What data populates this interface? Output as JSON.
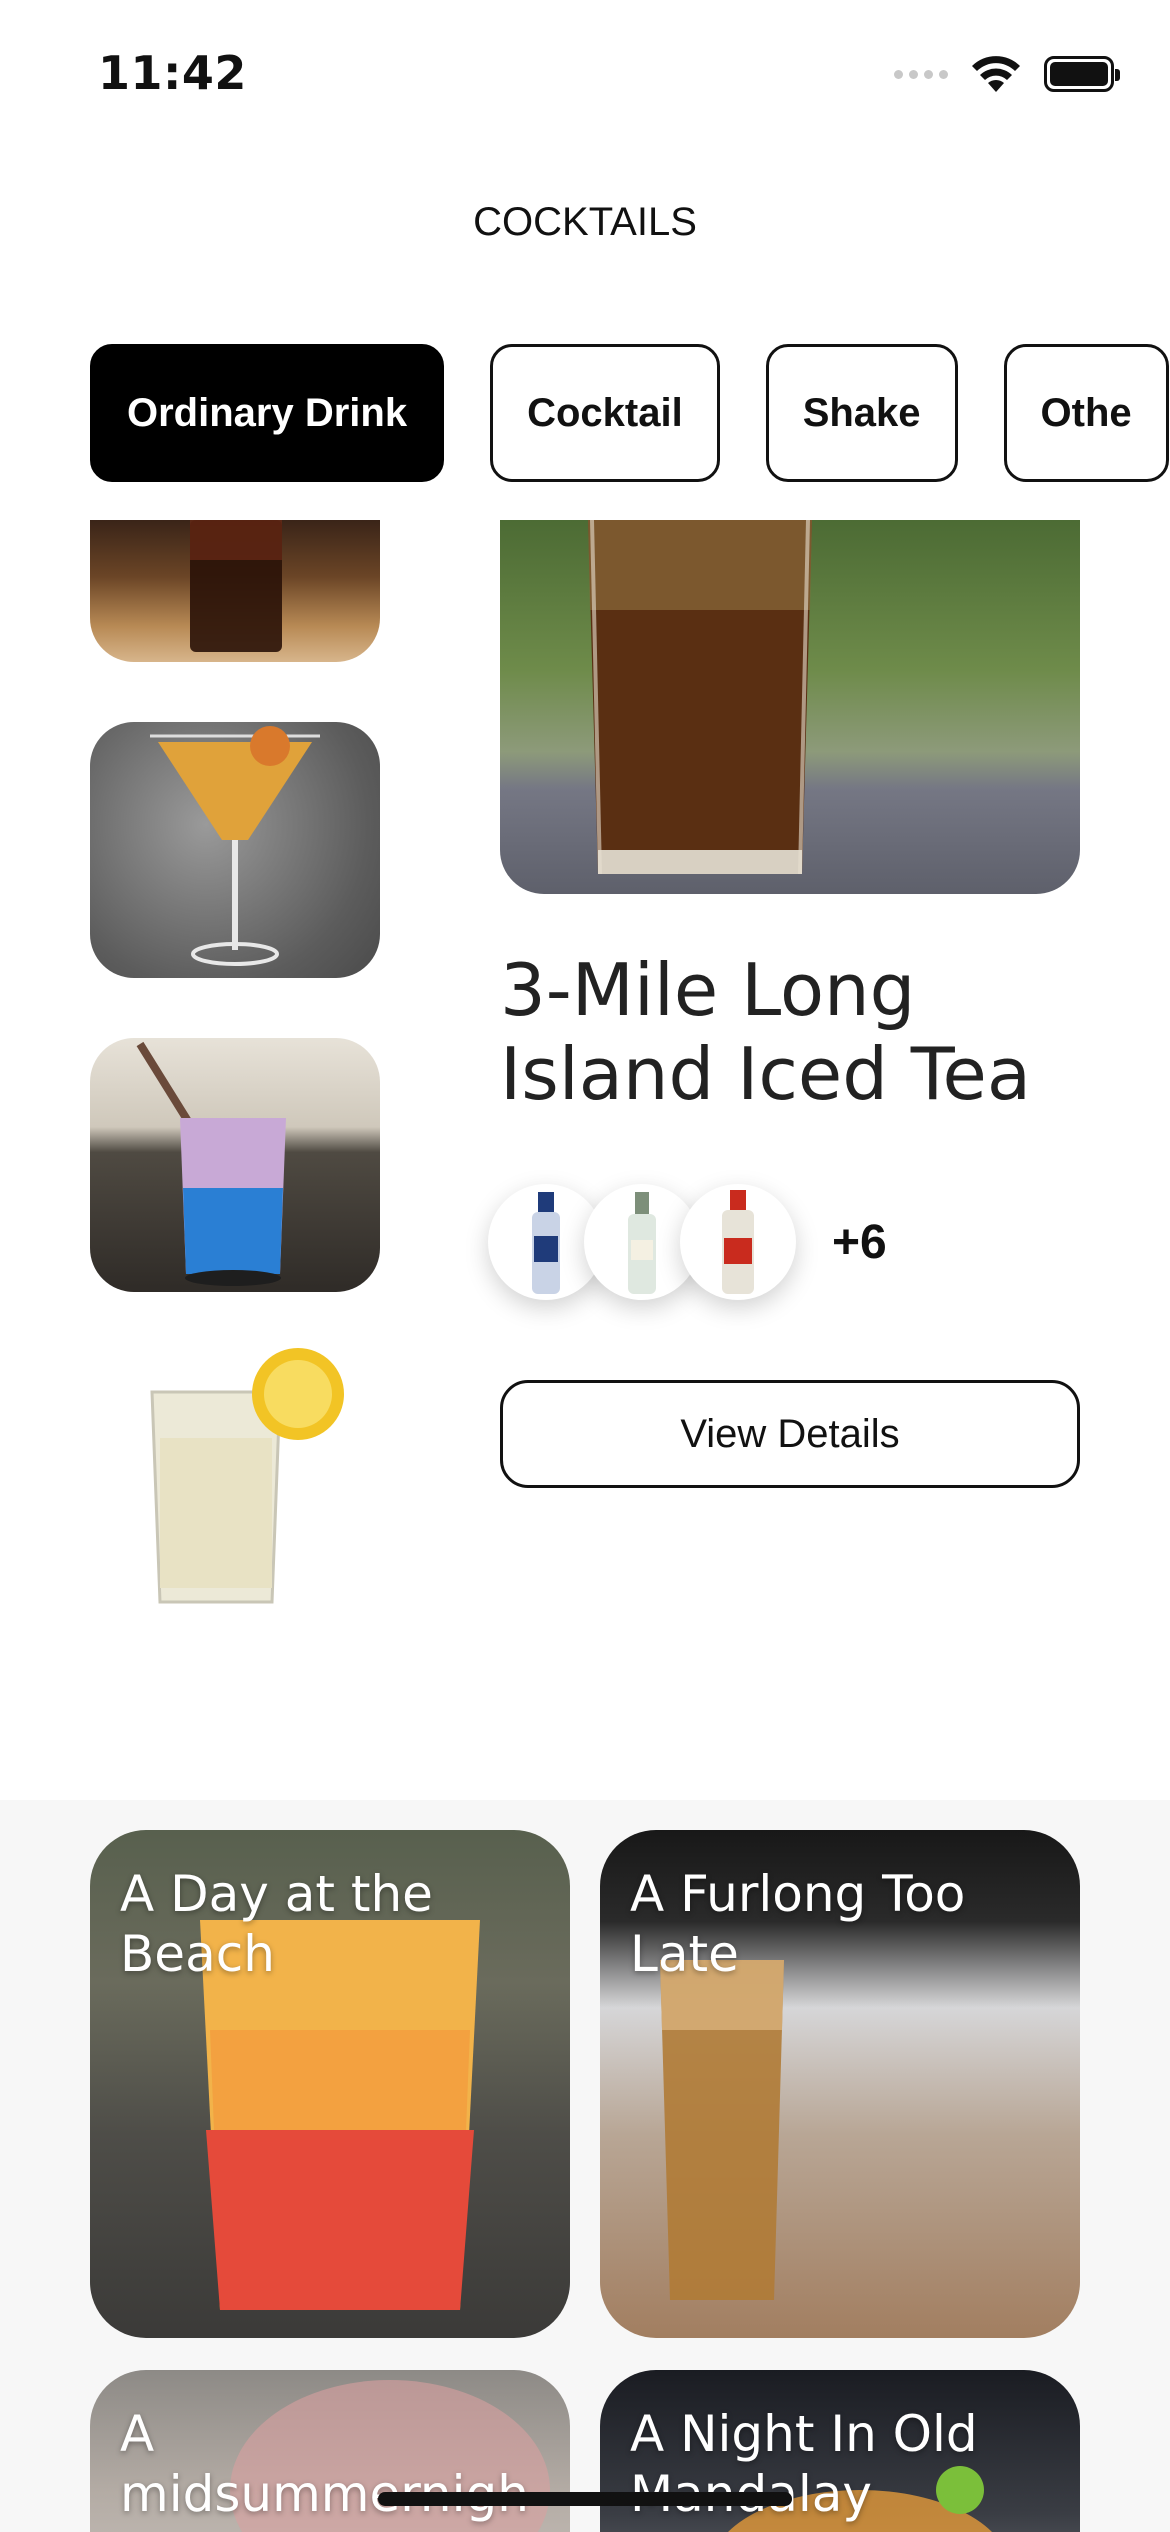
{
  "status_bar": {
    "time": "11:42"
  },
  "header": {
    "title": "COCKTAILS"
  },
  "categories": [
    {
      "label": "Ordinary Drink",
      "active": true
    },
    {
      "label": "Cocktail",
      "active": false
    },
    {
      "label": "Shake",
      "active": false
    },
    {
      "label": "Othe",
      "active": false
    }
  ],
  "featured": {
    "name_line1": "3-Mile Long",
    "name_line2": "Island Iced Tea",
    "ingredient_icons": [
      "vodka-bottle-icon",
      "rum-bottle-icon",
      "tequila-bottle-icon"
    ],
    "more_count": "+6",
    "details_button": "View Details"
  },
  "drinks": [
    {
      "title": "A Day at the Beach"
    },
    {
      "title": "A Furlong Too Late"
    },
    {
      "title": "A midsummernigh"
    },
    {
      "title": "A Night In Old Mandalay"
    }
  ],
  "colors": {
    "accent": "#000000",
    "background": "#ffffff",
    "grid_background": "#f7f7f7"
  }
}
